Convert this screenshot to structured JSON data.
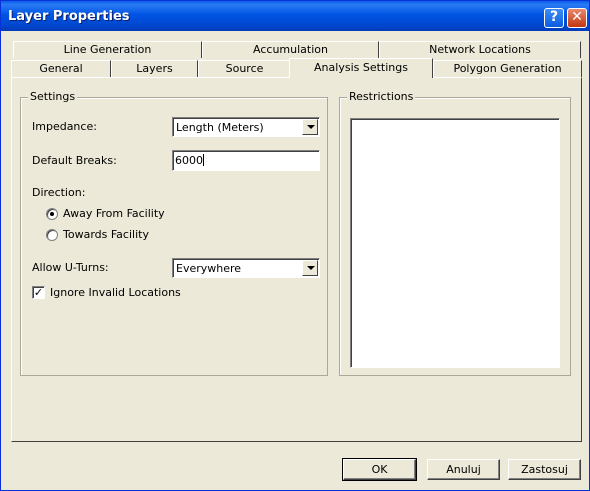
{
  "window": {
    "title": "Layer Properties",
    "help_glyph": "?",
    "close_glyph": "✕"
  },
  "tabs": {
    "back_row": [
      "Line Generation",
      "Accumulation",
      "Network Locations"
    ],
    "front_row": [
      "General",
      "Layers",
      "Source",
      "Analysis Settings",
      "Polygon Generation"
    ],
    "active": "Analysis Settings"
  },
  "settings": {
    "group_label": "Settings",
    "impedance_label": "Impedance:",
    "impedance_value": "Length (Meters)",
    "default_breaks_label": "Default Breaks:",
    "default_breaks_value": "6000",
    "direction_label": "Direction:",
    "direction_options": [
      "Away From Facility",
      "Towards Facility"
    ],
    "direction_selected": "Away From Facility",
    "uturns_label": "Allow U-Turns:",
    "uturns_value": "Everywhere",
    "ignore_invalid_label": "Ignore Invalid Locations",
    "ignore_invalid_checked": true,
    "check_glyph": "✓"
  },
  "restrictions": {
    "group_label": "Restrictions"
  },
  "buttons": {
    "ok": "OK",
    "cancel": "Anuluj",
    "apply": "Zastosuj"
  }
}
